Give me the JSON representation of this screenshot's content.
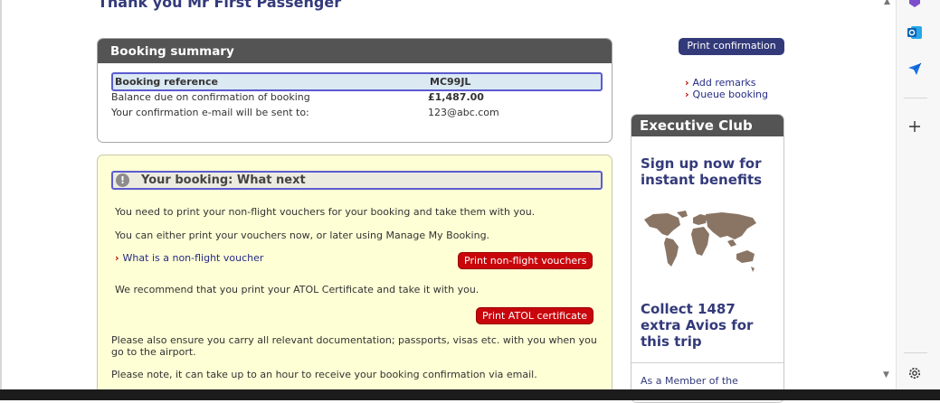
{
  "page": {
    "title": "Thank you Mr First Passenger"
  },
  "summary": {
    "header": "Booking summary",
    "ref_label": "Booking reference",
    "ref_value": "MC99JL",
    "balance_label": "Balance due on confirmation of booking",
    "balance_value": "£1,487.00",
    "email_label": "Your confirmation e-mail will be sent to:",
    "email_value": "123@abc.com"
  },
  "next": {
    "title": "Your booking: What next",
    "p1": "You need to print your non-flight vouchers for your booking and take them with you.",
    "p2": "You can either print your vouchers now, or later using Manage My Booking.",
    "voucher_link": "What is a non-flight voucher",
    "print_vouchers": "Print non-flight vouchers",
    "p3": "We recommend that you print your ATOL Certificate and take it with you.",
    "print_atol": "Print ATOL certificate",
    "p4": "Please also ensure you carry all relevant documentation; passports, visas etc. with you when you go to the airport.",
    "p5": "Please note, it can take up to an hour to receive your booking confirmation via email."
  },
  "sidebar": {
    "print_confirmation": "Print confirmation",
    "add_remarks": "Add remarks",
    "queue_booking": "Queue booking"
  },
  "exec_club": {
    "header": "Executive Club",
    "signup": "Sign up now for instant benefits",
    "collect": "Collect 1487 extra Avios for this trip",
    "member": "As a Member of the"
  },
  "colors": {
    "brand_navy": "#333a7a",
    "header_grey": "#545454",
    "button_red": "#c8060b",
    "what_next_bg": "#ffffd6",
    "highlight_border": "#5b5bcf"
  },
  "icons": {
    "info": "info-icon",
    "chevron": "chevron-right-icon",
    "map": "world-map-icon",
    "copilot": "copilot-icon",
    "outlook": "outlook-icon",
    "send": "send-icon",
    "add": "plus-icon",
    "settings": "gear-icon"
  }
}
